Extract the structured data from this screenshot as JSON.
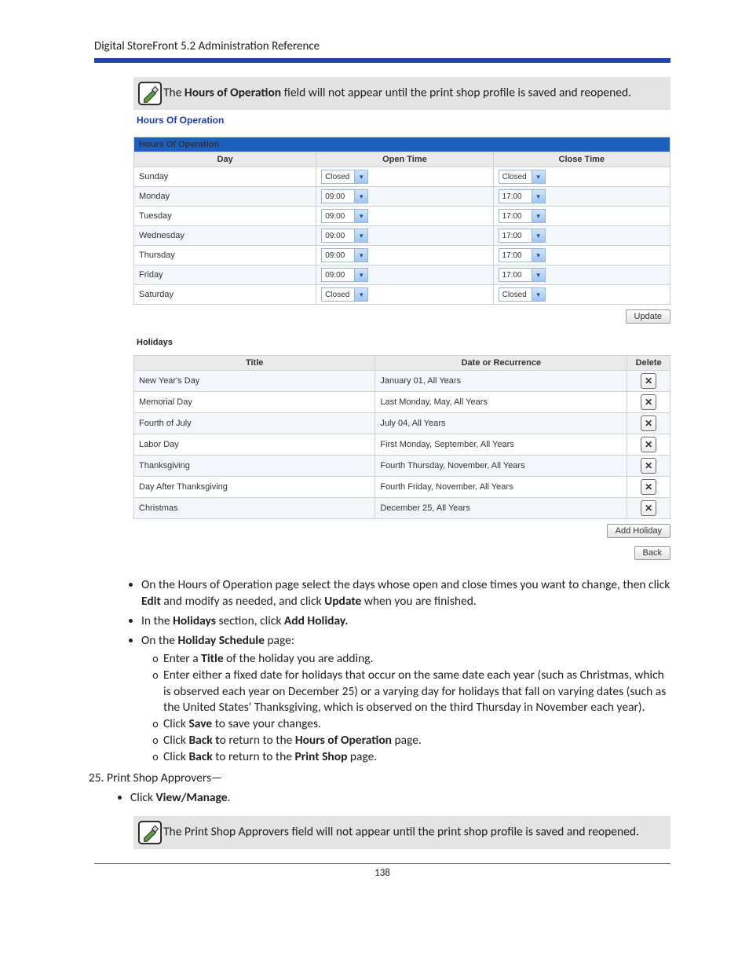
{
  "header": "Digital StoreFront 5.2 Administration Reference",
  "note1_prefix": "The ",
  "note1_bold": "Hours of Operation",
  "note1_suffix": " field will not appear until the print shop profile is saved and reopened.",
  "ss": {
    "section_title": "Hours Of Operation",
    "panel_title": "Hours Of Operation",
    "cols": {
      "day": "Day",
      "open": "Open Time",
      "close": "Close Time"
    },
    "rows": [
      {
        "day": "Sunday",
        "open": "Closed",
        "close": "Closed"
      },
      {
        "day": "Monday",
        "open": "09:00",
        "close": "17:00"
      },
      {
        "day": "Tuesday",
        "open": "09:00",
        "close": "17:00"
      },
      {
        "day": "Wednesday",
        "open": "09:00",
        "close": "17:00"
      },
      {
        "day": "Thursday",
        "open": "09:00",
        "close": "17:00"
      },
      {
        "day": "Friday",
        "open": "09:00",
        "close": "17:00"
      },
      {
        "day": "Saturday",
        "open": "Closed",
        "close": "Closed"
      }
    ],
    "update_btn": "Update",
    "holidays_label": "Holidays",
    "hcol": {
      "title": "Title",
      "date": "Date or Recurrence",
      "del": "Delete"
    },
    "holidays": [
      {
        "title": "New Year's Day",
        "date": "January 01, All Years"
      },
      {
        "title": "Memorial Day",
        "date": "Last Monday, May, All Years"
      },
      {
        "title": "Fourth of July",
        "date": "July 04, All Years"
      },
      {
        "title": "Labor Day",
        "date": "First Monday, September, All Years"
      },
      {
        "title": "Thanksgiving",
        "date": "Fourth Thursday, November, All Years"
      },
      {
        "title": "Day After Thanksgiving",
        "date": "Fourth Friday, November, All Years"
      },
      {
        "title": "Christmas",
        "date": "December 25, All Years"
      }
    ],
    "add_holiday_btn": "Add Holiday",
    "back_btn": "Back"
  },
  "instr": {
    "b1_pre": "On the Hours of Operation page select the days whose open and close times you want to change, then click ",
    "b1_edit": "Edit",
    "b1_mid": " and modify as needed, and click ",
    "b1_update": "Update",
    "b1_end": " when you are finished.",
    "b2_pre": "In the ",
    "b2_holidays": "Holidays",
    "b2_mid": " section, click ",
    "b2_addholiday": "Add Holiday.",
    "b3_pre": "On the ",
    "b3_hs": "Holiday Schedule",
    "b3_end": " page:",
    "s1_pre": "Enter a ",
    "s1_title": "Title",
    "s1_end": " of the holiday you are adding.",
    "s2": "Enter either a fixed date for holidays that occur on the same date each year (such as Christmas, which is observed each year on December 25) or a varying day for holidays that fall on varying dates (such as the United States' Thanksgiving, which is observed on the third Thursday in November each year).",
    "s3_pre": "Click ",
    "s3_save": "Save",
    "s3_end": " to save your changes.",
    "s4_pre": "Click ",
    "s4_back": "Back t",
    "s4_mid": "o return to the ",
    "s4_hoo": "Hours of Operation",
    "s4_end": " page.",
    "s5_pre": "Click ",
    "s5_back": "Back",
    "s5_mid": " to return to the ",
    "s5_ps": "Print Shop",
    "s5_end": " page.",
    "num25": "Print Shop Approvers—",
    "b4_pre": "Click ",
    "b4_vm": "View/Manage",
    "b4_end": "."
  },
  "note2": "The Print Shop Approvers field will not appear until the print shop profile is saved and reopened.",
  "page_num": "138"
}
